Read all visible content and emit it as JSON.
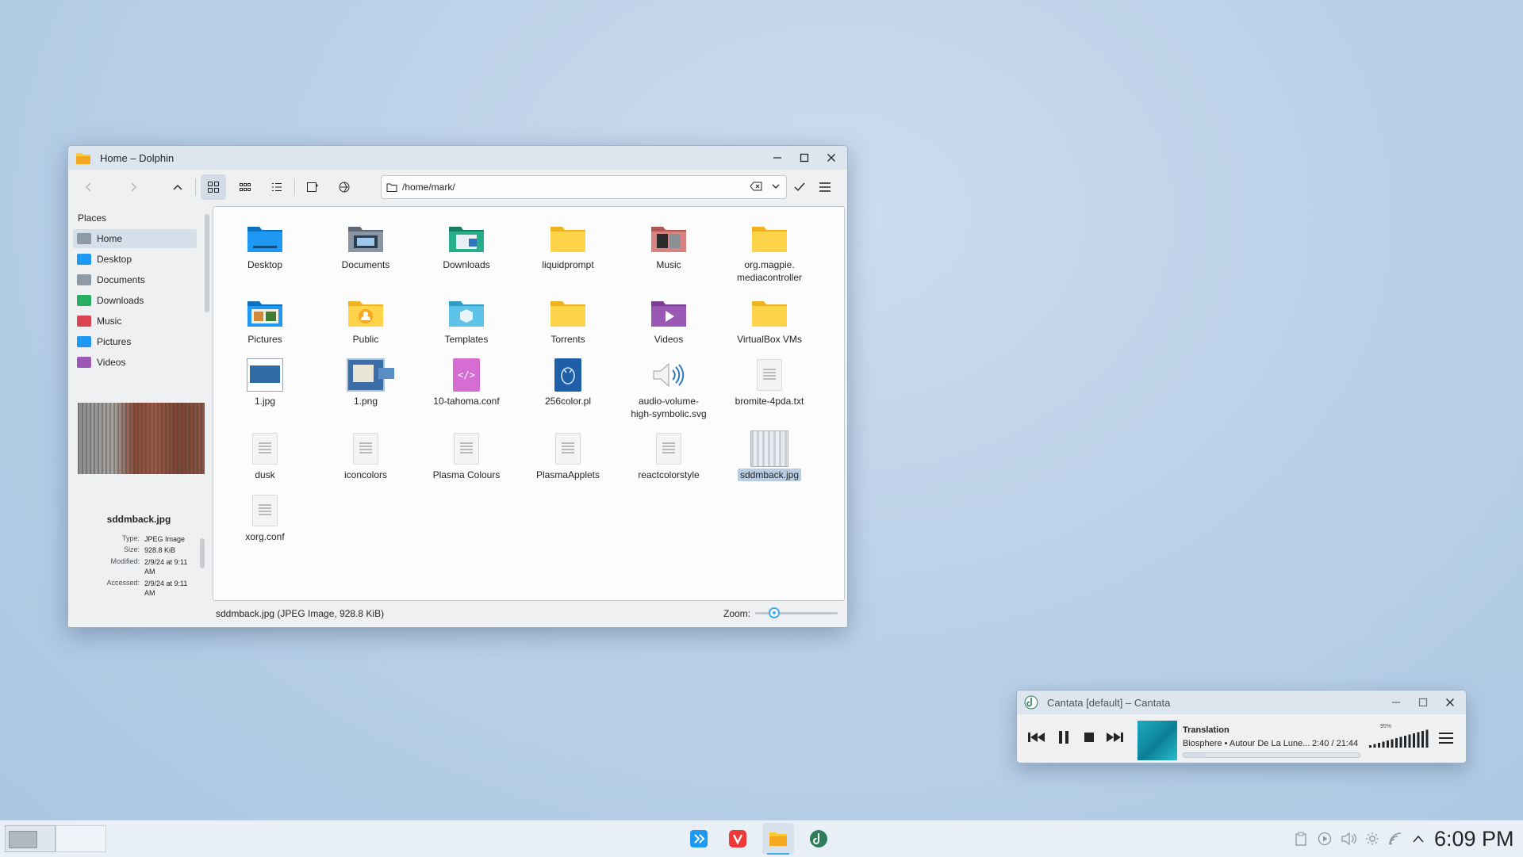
{
  "dolphin": {
    "title": "Home – Dolphin",
    "location": "/home/mark/",
    "places_header": "Places",
    "places": [
      {
        "label": "Home",
        "color": "#8e9aa6",
        "selected": true
      },
      {
        "label": "Desktop",
        "color": "#1d99f3"
      },
      {
        "label": "Documents",
        "color": "#8e9aa6"
      },
      {
        "label": "Downloads",
        "color": "#27ae60"
      },
      {
        "label": "Music",
        "color": "#da4453"
      },
      {
        "label": "Pictures",
        "color": "#1d99f3"
      },
      {
        "label": "Videos",
        "color": "#9b59b6"
      }
    ],
    "files": [
      {
        "label": "Desktop",
        "icon": "folder-desktop-icon"
      },
      {
        "label": "Documents",
        "icon": "folder-documents-icon"
      },
      {
        "label": "Downloads",
        "icon": "folder-downloads-icon"
      },
      {
        "label": "liquidprompt",
        "icon": "folder-icon"
      },
      {
        "label": "Music",
        "icon": "folder-music-icon"
      },
      {
        "label": "org.magpie.\nmediacontroller",
        "icon": "folder-icon"
      },
      {
        "label": "Pictures",
        "icon": "folder-pictures-icon"
      },
      {
        "label": "Public",
        "icon": "folder-public-icon"
      },
      {
        "label": "Templates",
        "icon": "folder-templates-icon"
      },
      {
        "label": "Torrents",
        "icon": "folder-icon"
      },
      {
        "label": "Videos",
        "icon": "folder-videos-icon"
      },
      {
        "label": "VirtualBox VMs",
        "icon": "folder-icon"
      },
      {
        "label": "1.jpg",
        "icon": "image-thumbnail-icon"
      },
      {
        "label": "1.png",
        "icon": "image-thumbnail-icon"
      },
      {
        "label": "10-tahoma.conf",
        "icon": "code-file-icon"
      },
      {
        "label": "256color.pl",
        "icon": "perl-file-icon"
      },
      {
        "label": "audio-volume-\nhigh-symbolic.svg",
        "icon": "speaker-icon"
      },
      {
        "label": "bromite-4pda.txt",
        "icon": "text-file-icon"
      },
      {
        "label": "dusk",
        "icon": "text-file-icon"
      },
      {
        "label": "iconcolors",
        "icon": "text-file-icon"
      },
      {
        "label": "Plasma Colours",
        "icon": "text-file-icon"
      },
      {
        "label": "PlasmaApplets",
        "icon": "text-file-icon"
      },
      {
        "label": "reactcolorstyle",
        "icon": "text-file-icon"
      },
      {
        "label": "sddmback.jpg",
        "icon": "image-thumbnail-icon",
        "selected": true
      },
      {
        "label": "xorg.conf",
        "icon": "text-file-icon"
      }
    ],
    "info": {
      "name": "sddmback.jpg",
      "rows": [
        {
          "key": "Type:",
          "value": "JPEG Image"
        },
        {
          "key": "Size:",
          "value": "928.8 KiB"
        },
        {
          "key": "Modified:",
          "value": "2/9/24 at 9:11 AM"
        },
        {
          "key": "Accessed:",
          "value": "2/9/24 at 9:11 AM"
        }
      ]
    },
    "status": "sddmback.jpg (JPEG Image, 928.8 KiB)",
    "zoom_label": "Zoom:",
    "zoom_level": 0.2
  },
  "cantata": {
    "title": "Cantata [default] – Cantata",
    "track_title": "Translation",
    "track_info": "Biosphere • Autour De La Lune...",
    "track_time": "2:40 / 21:44",
    "progress": 0.12,
    "volume": "95%"
  },
  "taskbar": {
    "clock": "6:09 PM",
    "tasks": [
      "kde-connect-icon",
      "vivaldi-icon",
      "dolphin-icon",
      "cantata-icon"
    ]
  },
  "colors": {
    "accent": "#3daee9",
    "folder_yellow": "#fdc92f",
    "folder_blue": "#1d99f3"
  }
}
